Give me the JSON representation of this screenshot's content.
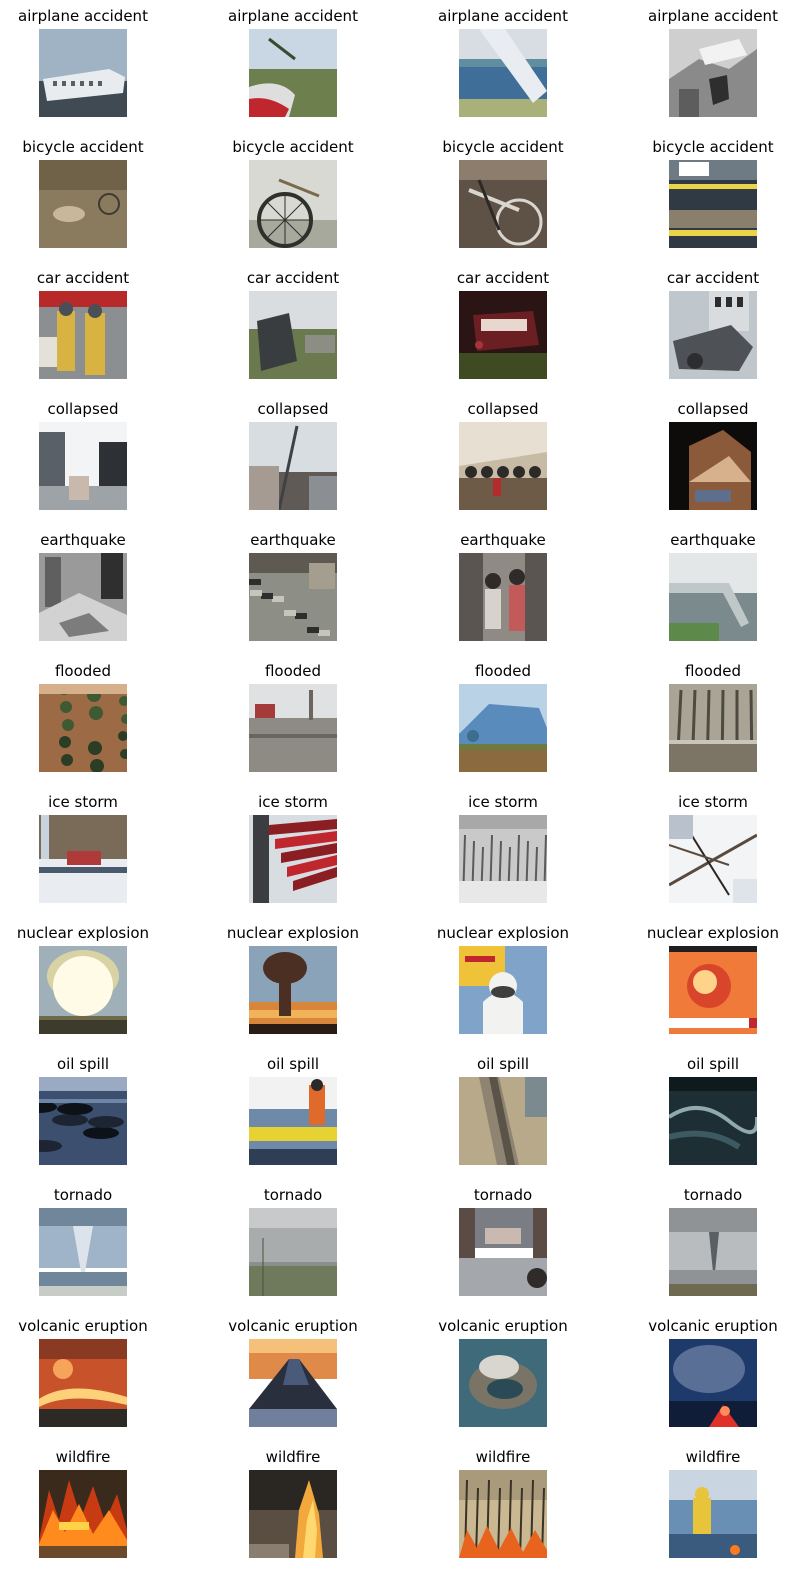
{
  "rows": [
    {
      "label": "airplane accident",
      "tiles": [
        {
          "scene": "sky-wreck",
          "colors": [
            "#9fb3c4",
            "#c9d3dc",
            "#e8ecef",
            "#5b5f63",
            "#3f4a52"
          ]
        },
        {
          "scene": "field-wreck",
          "colors": [
            "#c9d6e3",
            "#6d7f4c",
            "#dedede",
            "#c0262d",
            "#3b4a2e"
          ]
        },
        {
          "scene": "sea-wing",
          "colors": [
            "#7fa4c7",
            "#3f6f99",
            "#5f8ea0",
            "#a9b07a",
            "#d8dde3"
          ]
        },
        {
          "scene": "bw-wreck",
          "colors": [
            "#cfcfcf",
            "#8a8a8a",
            "#f2f2f2",
            "#2e2e2e",
            "#5d5d5d"
          ]
        }
      ]
    },
    {
      "label": "bicycle accident",
      "tiles": [
        {
          "scene": "road-person",
          "colors": [
            "#8a7b5e",
            "#6f6248",
            "#c9b79a",
            "#d3cfc7",
            "#3e3a32"
          ]
        },
        {
          "scene": "wheel-close",
          "colors": [
            "#d7d9d2",
            "#a6a99c",
            "#2f2f2b",
            "#7a6a4c",
            "#e9ebe4"
          ]
        },
        {
          "scene": "bike-frame",
          "colors": [
            "#5e5247",
            "#8c7d6c",
            "#d9d6cf",
            "#2c2926",
            "#a7978a"
          ]
        },
        {
          "scene": "tape-street",
          "colors": [
            "#2f3a44",
            "#e9d44a",
            "#6f7b84",
            "#ffffff",
            "#8a7f6a"
          ]
        }
      ]
    },
    {
      "label": "car accident",
      "tiles": [
        {
          "scene": "firefighters",
          "colors": [
            "#8b8f92",
            "#d9b342",
            "#b8292a",
            "#4a4f55",
            "#e4e1d9"
          ]
        },
        {
          "scene": "flipped-car",
          "colors": [
            "#d9dde0",
            "#6b7a4e",
            "#3a3d3f",
            "#8c8d85",
            "#b9bcb7"
          ]
        },
        {
          "scene": "night-car",
          "colors": [
            "#2a1414",
            "#6b1f22",
            "#a8343a",
            "#3d4a22",
            "#e8d7cf"
          ]
        },
        {
          "scene": "crushed-car",
          "colors": [
            "#bfc6cc",
            "#9aa0a4",
            "#4e5256",
            "#d8dcdf",
            "#2b2d2f"
          ]
        }
      ]
    },
    {
      "label": "collapsed",
      "tiles": [
        {
          "scene": "street-rubble",
          "colors": [
            "#f3f4f6",
            "#9ea3a8",
            "#5a6068",
            "#c9b9ad",
            "#2d3136"
          ]
        },
        {
          "scene": "tilted-pole",
          "colors": [
            "#d8dde2",
            "#8b8f93",
            "#5f5a55",
            "#3f4146",
            "#a59b92"
          ]
        },
        {
          "scene": "people-rubble",
          "colors": [
            "#c8bba5",
            "#6d5b47",
            "#2c2a28",
            "#b52a2a",
            "#e6dfd2"
          ]
        },
        {
          "scene": "night-house",
          "colors": [
            "#0e0c0b",
            "#8a5a3a",
            "#c08a5f",
            "#5d6f8a",
            "#d7b08c"
          ]
        }
      ]
    },
    {
      "label": "earthquake",
      "tiles": [
        {
          "scene": "bw-rubble",
          "colors": [
            "#9a9a9a",
            "#5f5f5f",
            "#d2d2d2",
            "#2f2f2f",
            "#7c7c7c"
          ]
        },
        {
          "scene": "debris-field",
          "colors": [
            "#8d8e86",
            "#5e5a52",
            "#c7c4bb",
            "#2e2f2c",
            "#a59e8f"
          ]
        },
        {
          "scene": "rescuers",
          "colors": [
            "#8f8a83",
            "#5a5550",
            "#d7d2cb",
            "#2e2b28",
            "#c35a5a"
          ]
        },
        {
          "scene": "broken-bridge",
          "colors": [
            "#bfc7c9",
            "#5d8a4a",
            "#7b8a8c",
            "#e3e7e8",
            "#3d5a32"
          ]
        }
      ]
    },
    {
      "label": "flooded",
      "tiles": [
        {
          "scene": "aerial-flood",
          "colors": [
            "#9c6b45",
            "#3f5a33",
            "#c08a5f",
            "#2c3d25",
            "#d6b08a"
          ]
        },
        {
          "scene": "street-flood",
          "colors": [
            "#b9bcbe",
            "#8e8a84",
            "#6a6560",
            "#a53a3a",
            "#dfe1e2"
          ]
        },
        {
          "scene": "roof-flood",
          "colors": [
            "#5a8bbd",
            "#3b6e8f",
            "#6f7a3f",
            "#8c6a3f",
            "#b9d2e6"
          ]
        },
        {
          "scene": "tree-flood",
          "colors": [
            "#7c7566",
            "#4d4a40",
            "#a9a495",
            "#2e2c26",
            "#c9c5b8"
          ]
        }
      ]
    },
    {
      "label": "ice storm",
      "tiles": [
        {
          "scene": "snow-truck",
          "colors": [
            "#e9edf2",
            "#7a6a58",
            "#b03a3a",
            "#4a5a6d",
            "#c9d3de"
          ]
        },
        {
          "scene": "red-seats",
          "colors": [
            "#d8dde2",
            "#c0262d",
            "#8b1e22",
            "#f2f3f5",
            "#3b3d40"
          ]
        },
        {
          "scene": "bw-forest",
          "colors": [
            "#c9c9c9",
            "#8f8f8f",
            "#e8e8e8",
            "#5a5a5a",
            "#a8a8a8"
          ]
        },
        {
          "scene": "ice-branches",
          "colors": [
            "#f3f4f6",
            "#5a4a3e",
            "#b9c2cc",
            "#2e2622",
            "#dfe4ea"
          ]
        }
      ]
    },
    {
      "label": "nuclear explosion",
      "tiles": [
        {
          "scene": "mushroom-bright",
          "colors": [
            "#fffbe6",
            "#d8d2a5",
            "#6e6a4a",
            "#9fb0b8",
            "#3d3b2b"
          ]
        },
        {
          "scene": "mushroom-dark",
          "colors": [
            "#8aa3b8",
            "#4a2f22",
            "#d8873a",
            "#f0b35a",
            "#2a1c15"
          ]
        },
        {
          "scene": "hazmat",
          "colors": [
            "#f0c23a",
            "#c0262d",
            "#f2f2f0",
            "#3e3f3f",
            "#7fa3c9"
          ]
        },
        {
          "scene": "tv-fireball",
          "colors": [
            "#f07a3a",
            "#d8452a",
            "#ffd38a",
            "#1e1e1e",
            "#ffffff"
          ]
        }
      ]
    },
    {
      "label": "oil spill",
      "tiles": [
        {
          "scene": "oily-shore",
          "colors": [
            "#3d4f6e",
            "#1d2533",
            "#6d86a8",
            "#0d1118",
            "#9aaac2"
          ]
        },
        {
          "scene": "boom-worker",
          "colors": [
            "#e6d232",
            "#e06a2a",
            "#6f8aa8",
            "#2e3f55",
            "#f2f2f2"
          ]
        },
        {
          "scene": "slick-road",
          "colors": [
            "#b8a98a",
            "#8f8472",
            "#d8cfbd",
            "#5a5348",
            "#7a8a8f"
          ]
        },
        {
          "scene": "river-aerial",
          "colors": [
            "#1e2e35",
            "#3d5a62",
            "#8fa9ae",
            "#0f1a1f",
            "#5f7d84"
          ]
        }
      ]
    },
    {
      "label": "tornado",
      "tiles": [
        {
          "scene": "funnel-sea",
          "colors": [
            "#9fb4c9",
            "#6f869b",
            "#dce3ea",
            "#4f5a4a",
            "#c8ccc6"
          ]
        },
        {
          "scene": "gray-field",
          "colors": [
            "#a9acad",
            "#8a8f8c",
            "#6f7a5c",
            "#c7c9ca",
            "#4a523f"
          ]
        },
        {
          "scene": "flooded-street",
          "colors": [
            "#7a7e84",
            "#5a4c44",
            "#c9b9b0",
            "#2f2b28",
            "#a4a8ad"
          ]
        },
        {
          "scene": "distant-funnel",
          "colors": [
            "#8f9396",
            "#b8bcbf",
            "#5a5f63",
            "#6e6a52",
            "#d5d8da"
          ]
        }
      ]
    },
    {
      "label": "volcanic eruption",
      "tiles": [
        {
          "scene": "lava-ridge",
          "colors": [
            "#c8532a",
            "#ffd07a",
            "#2d2a25",
            "#8a3a22",
            "#f6a45a"
          ]
        },
        {
          "scene": "cone-sunset",
          "colors": [
            "#e08a4a",
            "#4a5a7a",
            "#2a2f3d",
            "#f4c07a",
            "#6f7f9c"
          ]
        },
        {
          "scene": "island-aerial",
          "colors": [
            "#3e6a7a",
            "#7a7466",
            "#d9d6cf",
            "#2a4a56",
            "#a39c8c"
          ]
        },
        {
          "scene": "night-plume",
          "colors": [
            "#1e3a6a",
            "#0f1d38",
            "#5a6f96",
            "#e0302a",
            "#ff8a5a"
          ]
        }
      ]
    },
    {
      "label": "wildfire",
      "tiles": [
        {
          "scene": "flames-grass",
          "colors": [
            "#ff8a1e",
            "#c73a12",
            "#3a2a1c",
            "#ffd24a",
            "#6a4a2a"
          ]
        },
        {
          "scene": "flame-smoke",
          "colors": [
            "#2a2622",
            "#5a4e42",
            "#f2a83a",
            "#ffd970",
            "#8a7e70"
          ]
        },
        {
          "scene": "forest-fire",
          "colors": [
            "#6e6048",
            "#3a3224",
            "#e8641e",
            "#a89a7a",
            "#c9b892"
          ]
        },
        {
          "scene": "firefighter-smoke",
          "colors": [
            "#6a8fb5",
            "#3a5a7e",
            "#c9d6e2",
            "#e8c43a",
            "#2a3a4e"
          ]
        }
      ]
    }
  ]
}
